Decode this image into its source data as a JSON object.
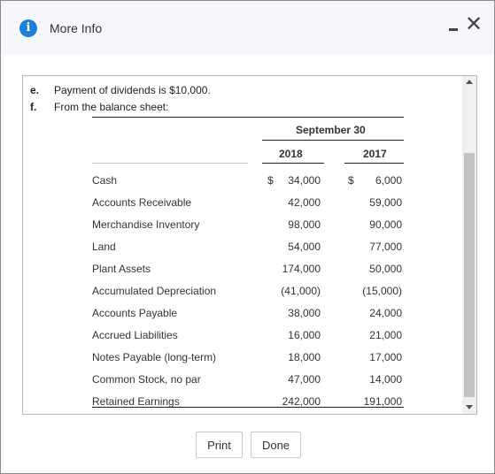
{
  "header": {
    "title": "More Info",
    "info_icon": "info-icon",
    "minimize_icon": "minimize-icon",
    "close_icon": "close-icon",
    "close_glyph": "✕"
  },
  "body": {
    "items": [
      {
        "label": "e.",
        "text": "Payment of dividends is $10,000."
      },
      {
        "label": "f.",
        "text": "From the balance sheet:"
      }
    ],
    "table": {
      "period_header": "September 30",
      "col_2018": "2018",
      "col_2017": "2017",
      "rows": [
        {
          "name": "Cash",
          "c1": "$",
          "v2018": "34,000",
          "c2": "$",
          "v2017": "6,000"
        },
        {
          "name": "Accounts Receivable",
          "c1": "",
          "v2018": "42,000",
          "c2": "",
          "v2017": "59,000"
        },
        {
          "name": "Merchandise Inventory",
          "c1": "",
          "v2018": "98,000",
          "c2": "",
          "v2017": "90,000"
        },
        {
          "name": "Land",
          "c1": "",
          "v2018": "54,000",
          "c2": "",
          "v2017": "77,000"
        },
        {
          "name": "Plant Assets",
          "c1": "",
          "v2018": "174,000",
          "c2": "",
          "v2017": "50,000"
        },
        {
          "name": "Accumulated Depreciation",
          "c1": "",
          "v2018": "(41,000)",
          "c2": "",
          "v2017": "(15,000)"
        },
        {
          "name": "Accounts Payable",
          "c1": "",
          "v2018": "38,000",
          "c2": "",
          "v2017": "24,000"
        },
        {
          "name": "Accrued Liabilities",
          "c1": "",
          "v2018": "16,000",
          "c2": "",
          "v2017": "21,000"
        },
        {
          "name": "Notes Payable (long-term)",
          "c1": "",
          "v2018": "18,000",
          "c2": "",
          "v2017": "17,000"
        },
        {
          "name": "Common Stock, no par",
          "c1": "",
          "v2018": "47,000",
          "c2": "",
          "v2017": "14,000"
        },
        {
          "name": "Retained Earnings",
          "c1": "",
          "v2018": "242,000",
          "c2": "",
          "v2017": "191,000"
        }
      ]
    }
  },
  "footer": {
    "print_label": "Print",
    "done_label": "Done"
  }
}
